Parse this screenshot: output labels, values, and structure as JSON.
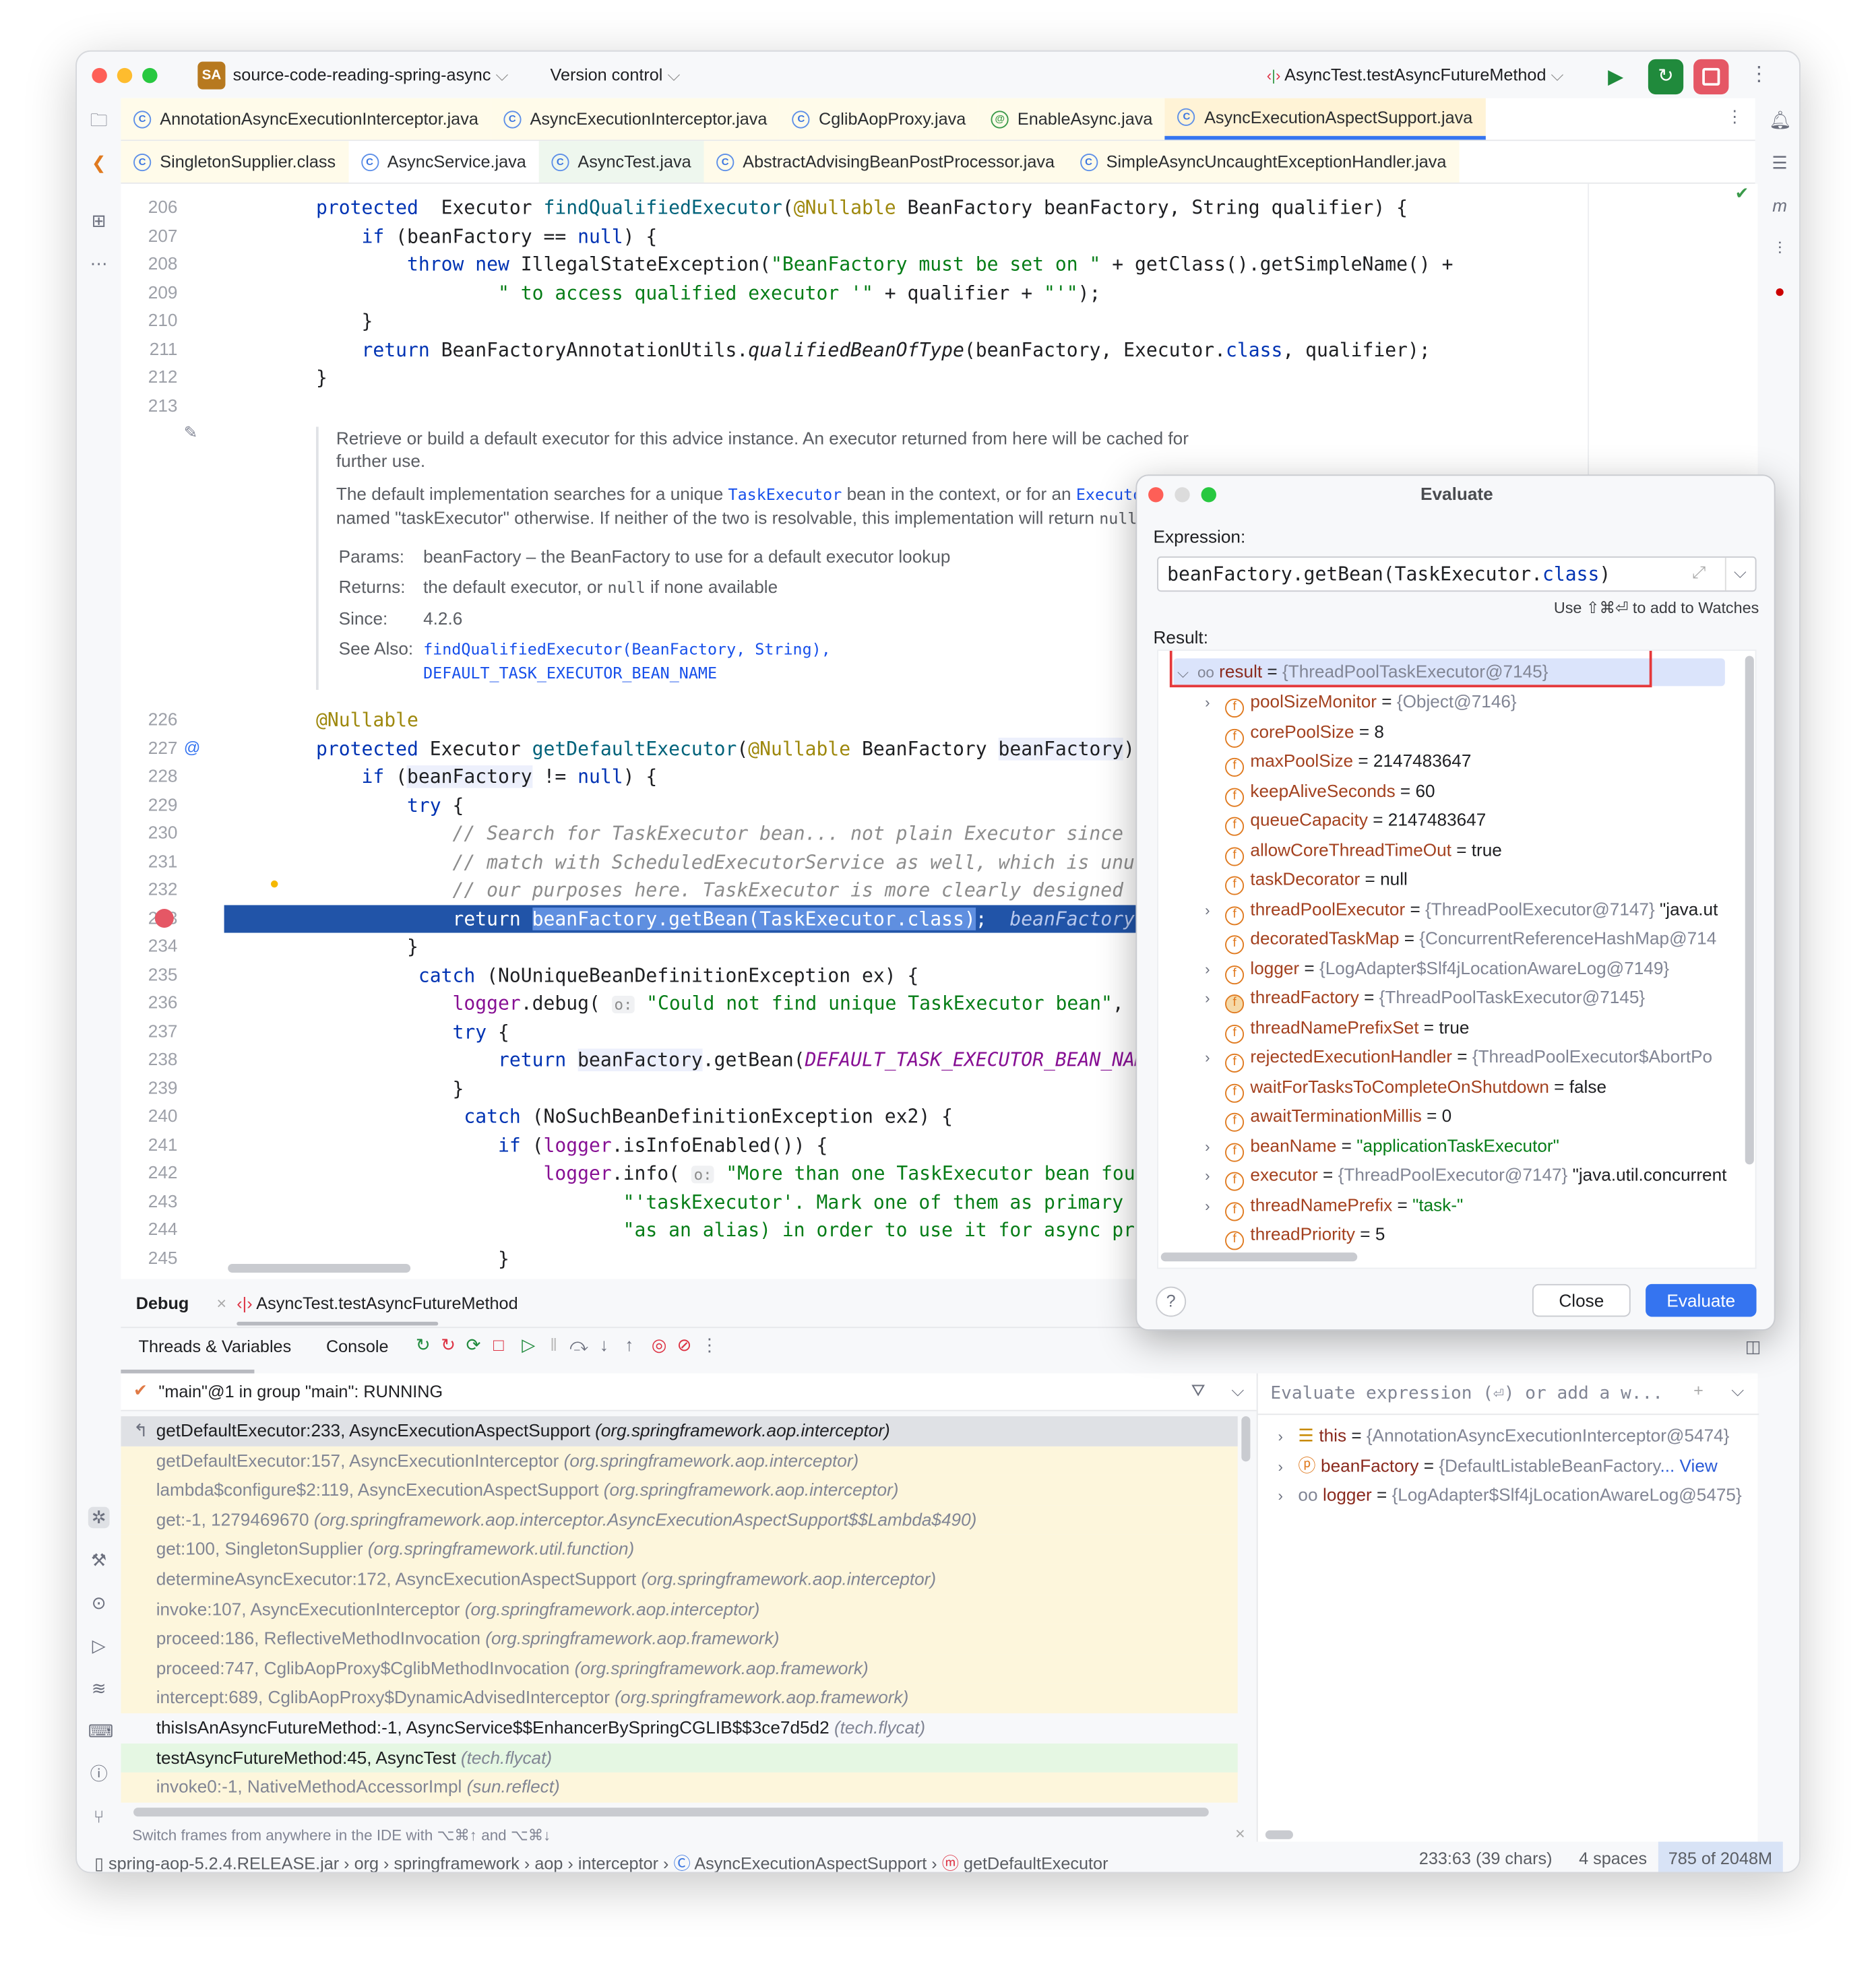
{
  "titlebar": {
    "project_badge": "SA",
    "project": "source-code-reading-spring-async",
    "vcs": "Version control",
    "run_config": "AsyncTest.testAsyncFutureMethod"
  },
  "tabs_row1": [
    {
      "label": "AnnotationAsyncExecutionInterceptor.java",
      "icon": "class-icon"
    },
    {
      "label": "AsyncExecutionInterceptor.java",
      "icon": "class-icon"
    },
    {
      "label": "CglibAopProxy.java",
      "icon": "class-icon"
    },
    {
      "label": "EnableAsync.java",
      "icon": "annotation-icon"
    },
    {
      "label": "AsyncExecutionAspectSupport.java",
      "icon": "class-icon",
      "active": true
    }
  ],
  "tabs_row2": [
    {
      "label": "SingletonSupplier.class"
    },
    {
      "label": "AsyncService.java"
    },
    {
      "label": "AsyncTest.java"
    },
    {
      "label": "AbstractAdvisingBeanPostProcessor.java"
    },
    {
      "label": "SimpleAsyncUncaughtExceptionHandler.java"
    }
  ],
  "code_top": [
    {
      "n": "206",
      "t": [
        [
          "kw",
          "protected"
        ],
        [
          "",
          "  Executor "
        ],
        [
          "fn",
          "findQualifiedExecutor"
        ],
        [
          "",
          "("
        ],
        [
          "ann",
          "@Nullable"
        ],
        [
          "",
          " BeanFactory beanFactory, String qualifier) {"
        ]
      ]
    },
    {
      "n": "207",
      "t": [
        [
          "",
          "    "
        ],
        [
          "kw",
          "if"
        ],
        [
          "",
          " (beanFactory == "
        ],
        [
          "kw",
          "null"
        ],
        [
          "",
          ") {"
        ]
      ]
    },
    {
      "n": "208",
      "t": [
        [
          "",
          "        "
        ],
        [
          "kw",
          "throw new"
        ],
        [
          "",
          " IllegalStateException("
        ],
        [
          "str",
          "\"BeanFactory must be set on \""
        ],
        [
          "",
          " + getClass().getSimpleName() +"
        ]
      ]
    },
    {
      "n": "209",
      "t": [
        [
          "",
          "                "
        ],
        [
          "str",
          "\" to access qualified executor '\""
        ],
        [
          "",
          " + qualifier + "
        ],
        [
          "str",
          "\"'\""
        ],
        [
          "",
          ");"
        ]
      ]
    },
    {
      "n": "210",
      "t": [
        [
          "",
          "    }"
        ]
      ]
    },
    {
      "n": "211",
      "t": [
        [
          "",
          "    "
        ],
        [
          "kw",
          "return"
        ],
        [
          "",
          " BeanFactoryAnnotationUtils."
        ],
        [
          "it",
          "qualifiedBeanOfType"
        ],
        [
          "",
          "(beanFactory, Executor."
        ],
        [
          "kw",
          "class"
        ],
        [
          "",
          ", qualifier);"
        ]
      ]
    },
    {
      "n": "212",
      "t": [
        [
          "",
          "}"
        ]
      ]
    },
    {
      "n": "213",
      "t": []
    }
  ],
  "doc": {
    "p1": "Retrieve or build a default executor for this advice instance. An executor returned from here will be cached for further use.",
    "p2a": "The default implementation searches for a unique ",
    "p2b": "TaskExecutor",
    "p2c": " bean in the context, or for an ",
    "p2d": "Executor",
    "p2e": " bean named \"taskExecutor\" otherwise. If neither of the two is resolvable, this implementation will return ",
    "p2f": "null",
    ".": ".",
    "params_label": "Params:",
    "params": "beanFactory – the BeanFactory to use for a default executor lookup",
    "returns_label": "Returns:",
    "returns_a": "the default executor, or ",
    "returns_b": "null",
    "returns_c": " if none available",
    "since_label": "Since:",
    "since": "4.2.6",
    "see_label": "See Also:",
    "see1": "findQualifiedExecutor(BeanFactory, String),",
    "see2": "DEFAULT_TASK_EXECUTOR_BEAN_NAME"
  },
  "code_bottom": [
    {
      "n": "226",
      "t": [
        [
          "ann",
          "@Nullable"
        ]
      ]
    },
    {
      "n": "227",
      "t": [
        [
          "kw",
          "protected"
        ],
        [
          "",
          " Executor "
        ],
        [
          "fn",
          "getDefaultExecutor"
        ],
        [
          "",
          "("
        ],
        [
          "ann",
          "@Nullable"
        ],
        [
          "",
          " BeanFactory "
        ],
        [
          "hl",
          "beanFactory"
        ],
        [
          "",
          ") {"
        ]
      ]
    },
    {
      "n": "228",
      "t": [
        [
          "",
          "    "
        ],
        [
          "kw",
          "if"
        ],
        [
          "",
          " ("
        ],
        [
          "hl",
          "beanFactory"
        ],
        [
          "",
          " != "
        ],
        [
          "kw",
          "null"
        ],
        [
          "",
          ") {"
        ]
      ]
    },
    {
      "n": "229",
      "t": [
        [
          "",
          "        "
        ],
        [
          "kw",
          "try"
        ],
        [
          "",
          " {"
        ]
      ]
    },
    {
      "n": "230",
      "t": [
        [
          "",
          "            "
        ],
        [
          "cm",
          "// Search for TaskExecutor bean... not plain Executor since that"
        ]
      ]
    },
    {
      "n": "231",
      "t": [
        [
          "",
          "            "
        ],
        [
          "cm",
          "// match with ScheduledExecutorService as well, which is unusable"
        ]
      ]
    },
    {
      "n": "232",
      "t": [
        [
          "",
          "            "
        ],
        [
          "cm",
          "// our purposes here. TaskExecutor is more clearly designed for it"
        ]
      ]
    },
    {
      "n": "233",
      "t": [
        [
          "",
          "            return "
        ],
        [
          "sel",
          "beanFactory.getBean(TaskExecutor.class)"
        ],
        [
          "",
          ";  "
        ],
        [
          "inl",
          "beanFactory: \"org.springframework"
        ]
      ]
    },
    {
      "n": "234",
      "t": [
        [
          "",
          "        }"
        ]
      ]
    },
    {
      "n": "235",
      "t": [
        [
          "",
          "         "
        ],
        [
          "kw",
          "catch"
        ],
        [
          "",
          " (NoUniqueBeanDefinitionException ex) {"
        ]
      ]
    },
    {
      "n": "236",
      "t": [
        [
          "",
          "            "
        ],
        [
          "fld",
          "logger"
        ],
        [
          "",
          ".debug( "
        ],
        [
          "hint",
          "o:"
        ],
        [
          "",
          " "
        ],
        [
          "str",
          "\"Could not find unique TaskExecutor bean\""
        ],
        [
          "",
          ", ex);"
        ]
      ]
    },
    {
      "n": "237",
      "t": [
        [
          "",
          "            "
        ],
        [
          "kw",
          "try"
        ],
        [
          "",
          " {"
        ]
      ]
    },
    {
      "n": "238",
      "t": [
        [
          "",
          "                "
        ],
        [
          "kw",
          "return"
        ],
        [
          "",
          " "
        ],
        [
          "hl",
          "beanFactory"
        ],
        [
          "",
          ".getBean("
        ],
        [
          "cst",
          "DEFAULT_TASK_EXECUTOR_BEAN_NAME"
        ],
        [
          "",
          ", "
        ]
      ]
    },
    {
      "n": "239",
      "t": [
        [
          "",
          "            }"
        ]
      ]
    },
    {
      "n": "240",
      "t": [
        [
          "",
          "             "
        ],
        [
          "kw",
          "catch"
        ],
        [
          "",
          " (NoSuchBeanDefinitionException ex2) {"
        ]
      ]
    },
    {
      "n": "241",
      "t": [
        [
          "",
          "                "
        ],
        [
          "kw",
          "if"
        ],
        [
          "",
          " ("
        ],
        [
          "fld",
          "logger"
        ],
        [
          "",
          ".isInfoEnabled()) {"
        ]
      ]
    },
    {
      "n": "242",
      "t": [
        [
          "",
          "                    "
        ],
        [
          "fld",
          "logger"
        ],
        [
          "",
          ".info( "
        ],
        [
          "hint",
          "o:"
        ],
        [
          "",
          " "
        ],
        [
          "str",
          "\"More than one TaskExecutor bean found within"
        ]
      ]
    },
    {
      "n": "243",
      "t": [
        [
          "",
          "                           "
        ],
        [
          "str",
          "\"'taskExecutor'. Mark one of them as primary or"
        ]
      ]
    },
    {
      "n": "244",
      "t": [
        [
          "",
          "                           "
        ],
        [
          "str",
          "\"as an alias) in order to use it for async process"
        ]
      ]
    },
    {
      "n": "245",
      "t": [
        [
          "",
          "                }"
        ]
      ]
    }
  ],
  "debug": {
    "tab_debug": "Debug",
    "session": "AsyncTest.testAsyncFutureMethod",
    "tab_threads": "Threads & Variables",
    "tab_console": "Console",
    "thread": "\"main\"@1 in group \"main\": RUNNING",
    "frames": [
      {
        "m": "getDefaultExecutor:233, AsyncExecutionAspectSupport",
        "p": "(org.springframework.aop.interceptor)",
        "kind": "sel"
      },
      {
        "m": "getDefaultExecutor:157, AsyncExecutionInterceptor",
        "p": "(org.springframework.aop.interceptor)",
        "kind": "lib"
      },
      {
        "m": "lambda$configure$2:119, AsyncExecutionAspectSupport",
        "p": "(org.springframework.aop.interceptor)",
        "kind": "lib"
      },
      {
        "m": "get:-1, 1279469670",
        "p": "(org.springframework.aop.interceptor.AsyncExecutionAspectSupport$$Lambda$490)",
        "kind": "lib"
      },
      {
        "m": "get:100, SingletonSupplier",
        "p": "(org.springframework.util.function)",
        "kind": "lib"
      },
      {
        "m": "determineAsyncExecutor:172, AsyncExecutionAspectSupport",
        "p": "(org.springframework.aop.interceptor)",
        "kind": "lib"
      },
      {
        "m": "invoke:107, AsyncExecutionInterceptor",
        "p": "(org.springframework.aop.interceptor)",
        "kind": "lib"
      },
      {
        "m": "proceed:186, ReflectiveMethodInvocation",
        "p": "(org.springframework.aop.framework)",
        "kind": "lib"
      },
      {
        "m": "proceed:747, CglibAopProxy$CglibMethodInvocation",
        "p": "(org.springframework.aop.framework)",
        "kind": "lib"
      },
      {
        "m": "intercept:689, CglibAopProxy$DynamicAdvisedInterceptor",
        "p": "(org.springframework.aop.framework)",
        "kind": "lib"
      },
      {
        "m": "thisIsAnAsyncFutureMethod:-1, AsyncService$$EnhancerBySpringCGLIB$$3ce7d5d2",
        "p": "(tech.flycat)",
        "kind": "user"
      },
      {
        "m": "testAsyncFutureMethod:45, AsyncTest",
        "p": "(tech.flycat)",
        "kind": "test"
      },
      {
        "m": "invoke0:-1, NativeMethodAccessorImpl",
        "p": "(sun.reflect)",
        "kind": "lib"
      }
    ],
    "hint": "Switch frames from anywhere in the IDE with ⌥⌘↑ and ⌥⌘↓",
    "watch_placeholder": "Evaluate expression (⏎) or add a w...",
    "vars": [
      {
        "icon": "this-icon",
        "name": "this",
        "value": "{AnnotationAsyncExecutionInterceptor@5474}"
      },
      {
        "icon": "parameter-icon",
        "name": "beanFactory",
        "value": "{DefaultListableBeanFactory",
        "link": "... View"
      },
      {
        "icon": "watch-icon",
        "name": "logger",
        "value": "{LogAdapter$Slf4jLocationAwareLog@5475}"
      }
    ]
  },
  "dialog": {
    "title": "Evaluate",
    "expression_label": "Expression:",
    "expression": "beanFactory.getBean(TaskExecutor.class)",
    "watch_hint": "Use ⇧⌘⏎ to add to Watches",
    "result_label": "Result:",
    "result": {
      "name": "result",
      "value": "{ThreadPoolTaskExecutor@7145}"
    },
    "fields": [
      {
        "n": "poolSizeMonitor",
        "v": "{Object@7146}",
        "k": "o",
        "x": true
      },
      {
        "n": "corePoolSize",
        "v": "8",
        "k": "k"
      },
      {
        "n": "maxPoolSize",
        "v": "2147483647",
        "k": "k"
      },
      {
        "n": "keepAliveSeconds",
        "v": "60",
        "k": "k"
      },
      {
        "n": "queueCapacity",
        "v": "2147483647",
        "k": "k"
      },
      {
        "n": "allowCoreThreadTimeOut",
        "v": "true",
        "k": "k"
      },
      {
        "n": "taskDecorator",
        "v": "null",
        "k": "k"
      },
      {
        "n": "threadPoolExecutor",
        "v": "{ThreadPoolExecutor@7147}",
        "extra": " \"java.ut",
        "k": "o",
        "x": true
      },
      {
        "n": "decoratedTaskMap",
        "v": "{ConcurrentReferenceHashMap@714",
        "k": "o"
      },
      {
        "n": "logger",
        "v": "{LogAdapter$Slf4jLocationAwareLog@7149}",
        "k": "o",
        "x": true
      },
      {
        "n": "threadFactory",
        "v": "{ThreadPoolTaskExecutor@7145}",
        "k": "o",
        "x": true
      },
      {
        "n": "threadNamePrefixSet",
        "v": "true",
        "k": "k"
      },
      {
        "n": "rejectedExecutionHandler",
        "v": "{ThreadPoolExecutor$AbortPo",
        "k": "o",
        "x": true
      },
      {
        "n": "waitForTasksToCompleteOnShutdown",
        "v": "false",
        "k": "k"
      },
      {
        "n": "awaitTerminationMillis",
        "v": "0",
        "k": "k"
      },
      {
        "n": "beanName",
        "v": "\"applicationTaskExecutor\"",
        "k": "s",
        "x": true
      },
      {
        "n": "executor",
        "v": "{ThreadPoolExecutor@7147}",
        "extra": " \"java.util.concurrent",
        "k": "o",
        "x": true
      },
      {
        "n": "threadNamePrefix",
        "v": "\"task-\"",
        "k": "s",
        "x": true
      },
      {
        "n": "threadPriority",
        "v": "5",
        "k": "k"
      }
    ],
    "close": "Close",
    "evaluate": "Evaluate",
    "help": "?"
  },
  "statusbar": {
    "crumbs": [
      "spring-aop-5.2.4.RELEASE.jar",
      "org",
      "springframework",
      "aop",
      "interceptor",
      "AsyncExecutionAspectSupport",
      "getDefaultExecutor"
    ],
    "position": "233:63 (39 chars)",
    "indent": "4 spaces",
    "memory": "785 of 2048M"
  },
  "colors": {
    "accent": "#3574f0",
    "exec_line": "#2154a8",
    "highlight_box": "#e5383b",
    "library_frame": "#fdf6dc",
    "test_frame": "#e5f7e3"
  }
}
